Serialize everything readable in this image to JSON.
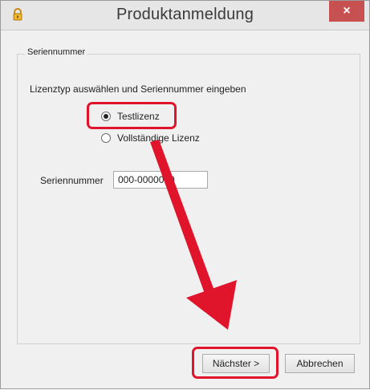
{
  "window": {
    "title": "Produktanmeldung",
    "close_glyph": "×",
    "icon": "key-lock-icon"
  },
  "group": {
    "legend": "Seriennummer",
    "instruction": "Lizenztyp auswählen und Seriennummer eingeben"
  },
  "license_options": [
    {
      "label": "Testlizenz",
      "selected": true
    },
    {
      "label": "Vollständige Lizenz",
      "selected": false
    }
  ],
  "serial": {
    "label": "Seriennummer",
    "value": "000-0000000"
  },
  "buttons": {
    "next": "Nächster >",
    "cancel": "Abbrechen"
  },
  "annotations": {
    "highlight_color": "#e0142b",
    "arrow_color": "#e0142b"
  }
}
